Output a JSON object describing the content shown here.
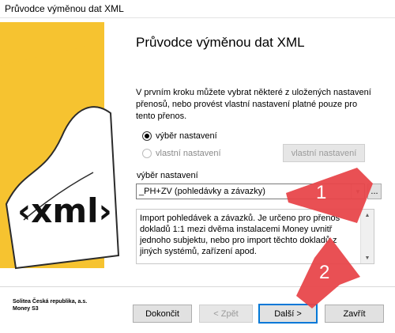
{
  "window": {
    "title": "Průvodce výměnou dat XML"
  },
  "logo": {
    "text": "‹xml›"
  },
  "heading": "Průvodce výměnou dat XML",
  "description": "V prvním kroku můžete vybrat některé z uložených nastavení přenosů, nebo provést vlastní nastavení platné pouze pro tento přenos.",
  "options": {
    "radio1_label": "výběr nastavení",
    "radio2_label": "vlastní nastavení",
    "custom_button_label": "vlastní nastavení"
  },
  "selection": {
    "label": "výběr nastavení",
    "value": "_PH+ZV (pohledávky a závazky)",
    "browse_label": "..."
  },
  "info_text": "Import pohledávek a závazků. Je určeno pro přenos dokladů 1:1 mezi dvěma instalacemi Money uvnitř jednoho subjektu, nebo pro import těchto dokladů z jiných systémů, zařízení apod.",
  "company": {
    "line1": "Solitea Česká republika, a.s.",
    "line2": "Money S3"
  },
  "buttons": {
    "finish": "Dokončit",
    "back": "< Zpět",
    "next": "Další >",
    "close": "Zavřít"
  },
  "annotations": {
    "n1": "1",
    "n2": "2",
    "color": "#e8474b"
  },
  "colors": {
    "logo_yellow": "#f6c330",
    "accent": "#0078d7"
  }
}
